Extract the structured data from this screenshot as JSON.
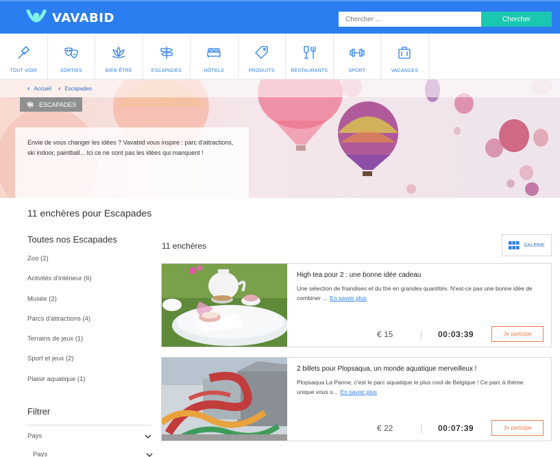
{
  "header": {
    "logo_text": "VAVABID",
    "search_placeholder": "Chercher ...",
    "search_button": "Chercher",
    "brand_color": "#2b7ef0",
    "accent_color": "#1ac7b0"
  },
  "categories": [
    {
      "label": "TOUT VOIR",
      "icon": "hammer-icon"
    },
    {
      "label": "SORTIES",
      "icon": "theater-masks-icon"
    },
    {
      "label": "BIEN-ÊTRE",
      "icon": "lotus-icon"
    },
    {
      "label": "ESCAPADES",
      "icon": "signpost-icon"
    },
    {
      "label": "HÔTELS",
      "icon": "bed-icon"
    },
    {
      "label": "PRODUITS",
      "icon": "tag-icon"
    },
    {
      "label": "RESTAURANTS",
      "icon": "glass-fork-icon"
    },
    {
      "label": "SPORT",
      "icon": "dumbbell-icon"
    },
    {
      "label": "VACANCES",
      "icon": "suitcase-icon"
    }
  ],
  "breadcrumb": [
    "Accueil",
    "Escapades"
  ],
  "hero": {
    "tag": "ESCAPADES",
    "description": "Envie de vous changer les idées ? Vavabid vous inspire : parc d'attractions, ski indoor, paintball... Ici ce ne sont pas les idées qui manquent !"
  },
  "page_heading": "11 enchères pour Escapades",
  "sidebar": {
    "title": "Toutes nos Escapades",
    "items": [
      "Zoo (2)",
      "Activités d'intérieur (6)",
      "Musée (2)",
      "Parcs d'attractions (4)",
      "Terrains de jeux (1)",
      "Sport et jeux (2)",
      "Plaisir aquatique (1)"
    ],
    "filter_title": "Filtrer",
    "filters": [
      "Pays",
      "Pays"
    ]
  },
  "results": {
    "count_label": "11 enchères",
    "view_button": "GALERIE",
    "cards": [
      {
        "title": "High tea pour 2 : une bonne idée cadeau",
        "description": "Une sélection de friandises et du thé en grandes quantités. N'est-ce pas une bonne idée de combiner ...",
        "more": "En savoir plus",
        "price": "€ 15",
        "timer": "00:03:39",
        "cta": "Je participe"
      },
      {
        "title": "2 billets pour Plopsaqua, un monde aquatique merveilleux !",
        "description": "Plopsaqua La Panne, c'est le parc aquatique le plus cool de Belgique ! Ce parc à thème unique vous s...",
        "more": "En savoir plus",
        "price": "€ 22",
        "timer": "00:07:39",
        "cta": "Je participe"
      }
    ]
  }
}
